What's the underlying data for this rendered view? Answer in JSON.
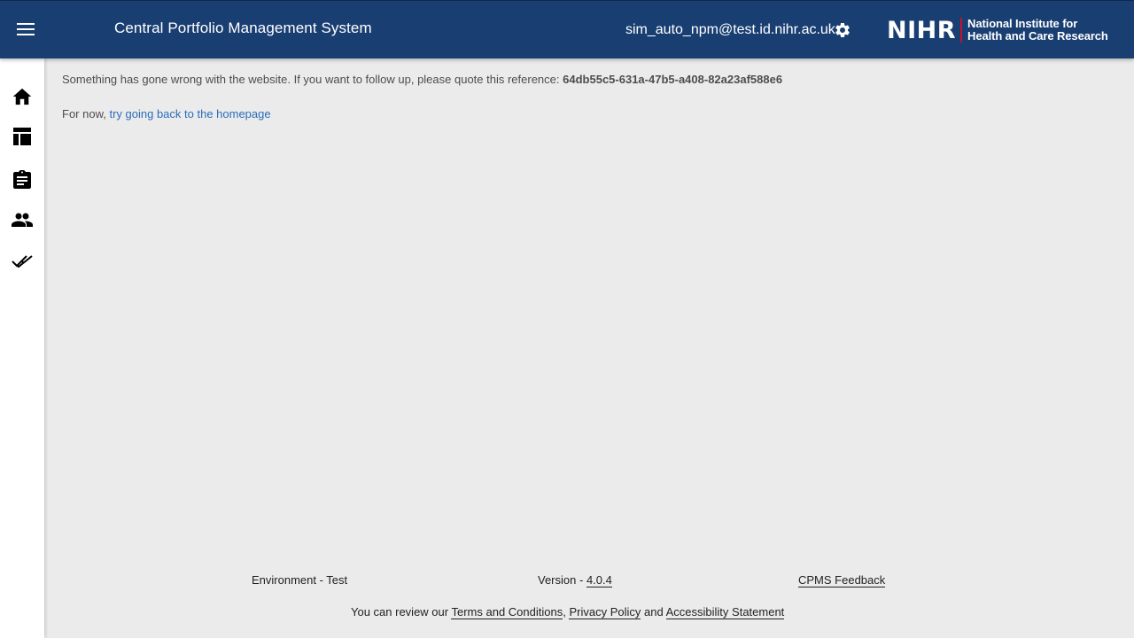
{
  "header": {
    "app_title": "Central Portfolio Management System",
    "user_email": "sim_auto_npm@test.id.nihr.ac.uk",
    "logo": {
      "wordmark": "NIHR",
      "line1": "National Institute for",
      "line2": "Health and Care Research"
    },
    "colors": {
      "header_bg": "#193e72",
      "logo_accent": "#c8102e"
    }
  },
  "sidebar": {
    "items": [
      {
        "icon": "home-icon"
      },
      {
        "icon": "table-icon"
      },
      {
        "icon": "clipboard-icon"
      },
      {
        "icon": "people-icon"
      },
      {
        "icon": "double-check-icon"
      }
    ]
  },
  "main": {
    "error_message": "Something has gone wrong with the website. If you want to follow up, please quote this reference:",
    "reference": "64db55c5-631a-47b5-a408-82a23af588e6",
    "followup_prefix": "For now,",
    "homepage_link": "try going back to the homepage"
  },
  "footer": {
    "environment": "Environment - Test",
    "version_prefix": "Version -",
    "version": "4.0.4",
    "feedback": "CPMS Feedback",
    "review_prefix": "You can review our",
    "terms": "Terms and Conditions",
    "comma": ",",
    "privacy": "Privacy Policy",
    "and": "and",
    "accessibility": "Accessibility Statement"
  }
}
